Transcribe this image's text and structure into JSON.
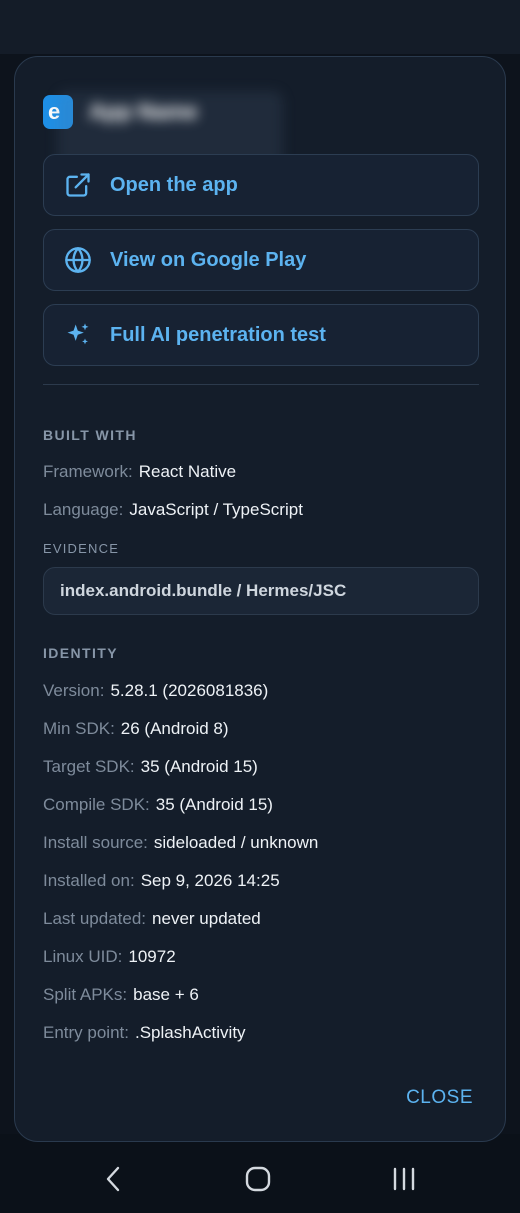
{
  "app": {
    "icon_letter": "e",
    "name": "App Name"
  },
  "actions": [
    {
      "label": "Open the app",
      "icon": "open-external-icon"
    },
    {
      "label": "View on Google Play",
      "icon": "globe-icon"
    },
    {
      "label": "Full AI penetration test",
      "icon": "sparkle-icon"
    }
  ],
  "built_with": {
    "title": "BUILT WITH",
    "framework_key": "Framework:",
    "framework_val": "React Native",
    "language_key": "Language:",
    "language_val": "JavaScript / TypeScript",
    "evidence_title": "EVIDENCE",
    "evidence_val": "index.android.bundle / Hermes/JSC"
  },
  "identity": {
    "title": "IDENTITY",
    "rows": [
      {
        "k": "Version:",
        "v": "5.28.1 (2026081836)"
      },
      {
        "k": "Min SDK:",
        "v": "26 (Android 8)"
      },
      {
        "k": "Target SDK:",
        "v": "35 (Android 15)"
      },
      {
        "k": "Compile SDK:",
        "v": "35 (Android 15)"
      },
      {
        "k": "Install source:",
        "v": "sideloaded / unknown"
      },
      {
        "k": "Installed on:",
        "v": "Sep 9, 2026 14:25"
      },
      {
        "k": "Last updated:",
        "v": "never updated"
      },
      {
        "k": "Linux UID:",
        "v": "10972"
      },
      {
        "k": "Split APKs:",
        "v": "base + 6"
      },
      {
        "k": "Entry point:",
        "v": ".SplashActivity"
      }
    ]
  },
  "close_label": "CLOSE",
  "colors": {
    "accent": "#5cb3f0",
    "dialog_bg": "#141d2a",
    "app_icon": "#1e8fe6"
  }
}
